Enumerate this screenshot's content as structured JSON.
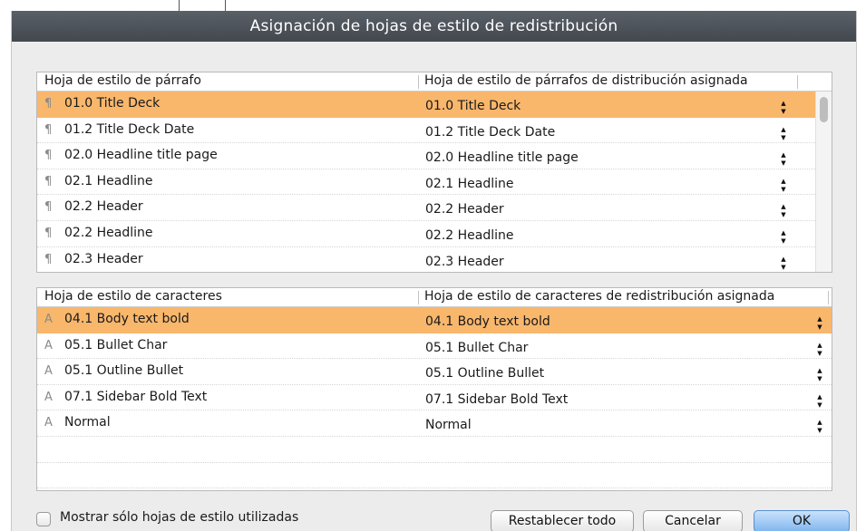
{
  "dialog": {
    "title": "Asignación de hojas de estilo de redistribución"
  },
  "paragraph_table": {
    "columns": [
      "Hoja de estilo de párrafo",
      "Hoja de estilo de párrafos de distribución asignada"
    ],
    "glyph": "¶",
    "rows": [
      {
        "name": "01.0 Title Deck",
        "assigned": "01.0 Title Deck",
        "selected": true
      },
      {
        "name": "01.2 Title Deck Date",
        "assigned": "01.2 Title Deck Date",
        "selected": false
      },
      {
        "name": "02.0 Headline title page",
        "assigned": "02.0 Headline title page",
        "selected": false
      },
      {
        "name": "02.1 Headline",
        "assigned": "02.1 Headline",
        "selected": false
      },
      {
        "name": "02.2 Header",
        "assigned": "02.2 Header",
        "selected": false
      },
      {
        "name": "02.2 Headline",
        "assigned": "02.2 Headline",
        "selected": false
      },
      {
        "name": "02.3 Header",
        "assigned": "02.3 Header",
        "selected": false
      }
    ]
  },
  "character_table": {
    "columns": [
      "Hoja de estilo de caracteres",
      "Hoja de estilo de caracteres de redistribución asignada"
    ],
    "glyph": "A",
    "rows": [
      {
        "name": "04.1 Body text bold",
        "assigned": "04.1 Body text bold",
        "selected": true
      },
      {
        "name": "05.1 Bullet Char",
        "assigned": "05.1 Bullet Char",
        "selected": false
      },
      {
        "name": "05.1 Outline Bullet",
        "assigned": "05.1 Outline Bullet",
        "selected": false
      },
      {
        "name": "07.1 Sidebar Bold Text",
        "assigned": "07.1 Sidebar Bold Text",
        "selected": false
      },
      {
        "name": "Normal",
        "assigned": "Normal",
        "selected": false
      }
    ]
  },
  "footer": {
    "checkbox_label": "Mostrar sólo hojas de estilo utilizadas",
    "checkbox_checked": false,
    "reset_label": "Restablecer todo",
    "cancel_label": "Cancelar",
    "ok_label": "OK"
  },
  "colors": {
    "selection": "#f9b76c",
    "titlebar": "#4b5058",
    "default_button": "#7fb5ef"
  }
}
